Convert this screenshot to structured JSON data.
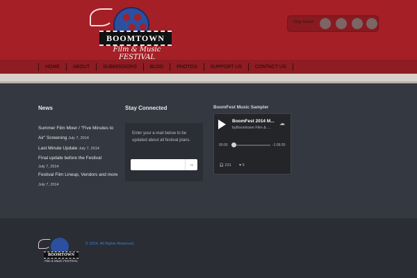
{
  "header": {
    "logo": {
      "title": "BOOMTOWN",
      "subtitle": "Film & Music",
      "tagline": "FESTIVAL"
    },
    "stay_tuned_label": "Stay tuned",
    "social_icons": [
      "facebook-icon",
      "twitter-icon",
      "youtube-icon",
      "rss-icon"
    ]
  },
  "nav": {
    "items": [
      "HOME",
      "ABOUT",
      "SUBMISSIONS",
      "BLOG",
      "PHOTOS",
      "SUPPORT US",
      "CONTACT US"
    ]
  },
  "news": {
    "title": "News",
    "items": [
      {
        "title": "Summer Film Mixer / \"Five Minutes to Air\" Screening",
        "date": "July 7, 2014"
      },
      {
        "title": "Last Minute Update",
        "date": "July 7, 2014"
      },
      {
        "title": "Final update before the Festival",
        "date": "July 7, 2014"
      },
      {
        "title": "Festival Film Lineup, Vendors and more",
        "date": "July 7, 2014"
      }
    ]
  },
  "stay_connected": {
    "title": "Stay Connected",
    "text": "Enter your e-mail below to be updated about all festival plans.",
    "email_placeholder": "",
    "submit_label": "→"
  },
  "sampler": {
    "title": "BoomFest Music Sampler",
    "track": "BoomFest 2014 M...",
    "artist_prefix": "by",
    "artist": "Boomtown Film & ...",
    "time_current": "00:00",
    "time_remaining": "-1:09:30",
    "plays": "231",
    "likes": "5",
    "progress": 0
  },
  "footer": {
    "copyright": "© 2014. All Rights Reserved."
  },
  "colors": {
    "header_red": "#a51f26",
    "nav_red": "#8e1c22",
    "body_bg": "#343841",
    "footer_bg": "#2a2d34",
    "link_blue": "#3f7fd6"
  }
}
